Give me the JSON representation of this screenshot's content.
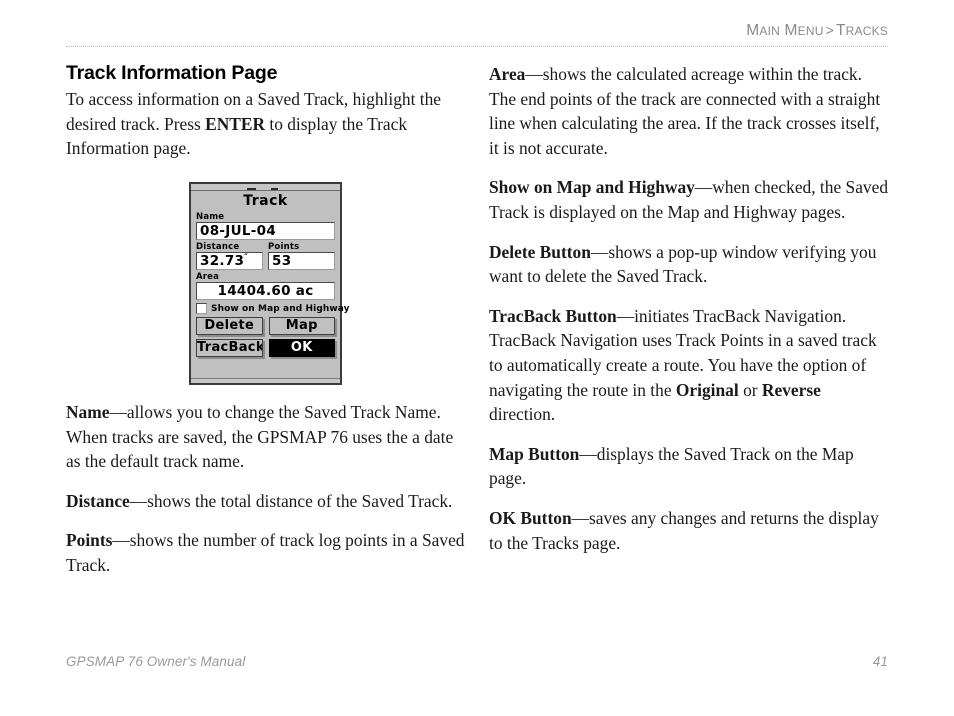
{
  "running_head": {
    "part1_big": "M",
    "part1_small": "AIN",
    "part2_big": "M",
    "part2_small": "ENU",
    "separator": ">",
    "part3_big": "T",
    "part3_small": "RACKS",
    "full_text": "MAIN MENU > TRACKS",
    "color": "#8a8a8a"
  },
  "left_column": {
    "heading": "Track Information Page",
    "intro_pre": "To access information on a Saved Track, highlight the desired track. Press ",
    "intro_bold": "ENTER",
    "intro_post": " to display the Track Information page.",
    "entries": [
      {
        "term": "Name",
        "dash": "—",
        "text": "allows you to change the Saved Track Name. When tracks are saved, the GPSMAP 76 uses the a date as the default track name."
      },
      {
        "term": "Distance",
        "dash": "—",
        "text": "shows the total distance of the Saved Track."
      },
      {
        "term": "Points",
        "dash": "—",
        "text": "shows the number of track log points in a Saved Track."
      }
    ]
  },
  "right_column": {
    "entries": [
      {
        "term": "Area",
        "dash": "—",
        "text": "shows the calculated acreage within the track. The end points of the track are connected with a straight line when calculating the area. If the track crosses itself, it is not accurate."
      },
      {
        "term": "Show on Map and Highway",
        "dash": "—",
        "text": "when checked, the Saved Track is displayed on the Map and Highway pages."
      },
      {
        "term": "Delete Button",
        "dash": "—",
        "text": "shows a pop-up window verifying you want to delete the Saved Track."
      }
    ],
    "tracback": {
      "term": "TracBack Button",
      "dash": "—",
      "text_pre": "initiates TracBack Navigation. TracBack Navigation uses Track Points in a saved track to automatically create a route. You have the option of navigating the route in the ",
      "bold1": "Original",
      "mid": " or ",
      "bold2": "Reverse",
      "text_post": " direction."
    },
    "entries_tail": [
      {
        "term": "Map Button",
        "dash": "—",
        "text": "displays the Saved Track on the Map page."
      },
      {
        "term": "OK Button",
        "dash": "—",
        "text": "saves any changes and returns the display to the Tracks page."
      }
    ]
  },
  "device_screenshot": {
    "title": "Track",
    "name_label": "Name",
    "name_value": "08-JUL-04",
    "distance_label": "Distance",
    "distance_value": "32.73",
    "distance_unit_sup": "″",
    "points_label": "Points",
    "points_value": "53",
    "area_label": "Area",
    "area_value": "14404.60 ac",
    "checkbox_label": "Show on Map and Highway",
    "checkbox_checked": false,
    "buttons": [
      {
        "label": "Delete",
        "selected": false
      },
      {
        "label": "Map",
        "selected": false
      },
      {
        "label": "TracBack",
        "selected": false
      },
      {
        "label": "OK",
        "selected": true
      }
    ],
    "screen_bg": "#c0c0c0",
    "field_bg": "#ffffff",
    "selected_bg": "#000000"
  },
  "footer": {
    "manual_title": "GPSMAP 76 Owner's Manual",
    "page_number": "41"
  }
}
